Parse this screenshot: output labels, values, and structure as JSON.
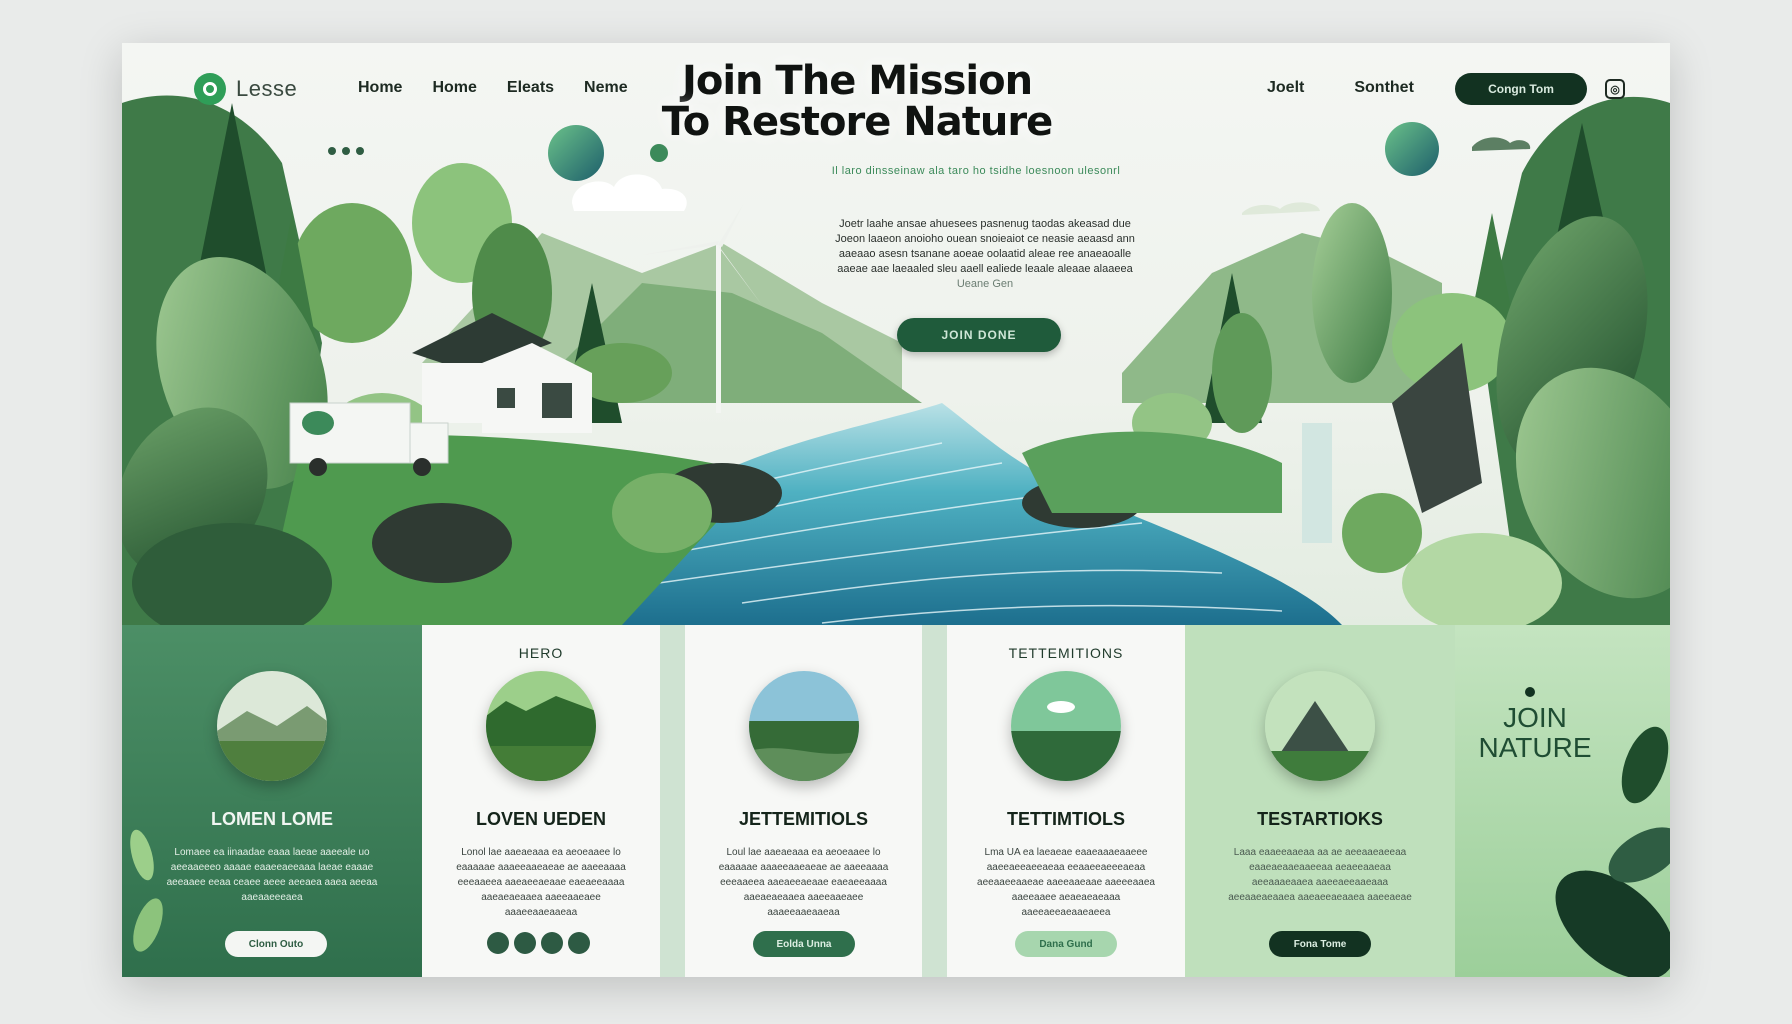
{
  "nav": {
    "logo_text": "Lesse",
    "links": [
      "Home",
      "Home",
      "Eleats",
      "Neme"
    ],
    "right_links": [
      "Joelt",
      "Sonthet"
    ],
    "cta_label": "Congn Tom",
    "social_icon": "instagram-icon"
  },
  "hero": {
    "title_line1": "Join The Mission",
    "title_line2": "To Restore Nature",
    "subtitle": "Il laro dinsseinaw ala taro ho tsidhe loesnoon ulesonrl",
    "body_line1": "Joetr laahe ansae ahuesees pasnenug taodas akeasad due",
    "body_line2": "Joeon laaeon anoioho ouean snoieaiot ce neasie aeaasd ann",
    "body_line3": "aaeaao asesn tsanane aoeae oolaatid aleae ree anaeaoalle",
    "body_line4": "aaeae aae laeaaled sleu aaell ealiede leaale aleaae alaaeea",
    "body_line5": "Ueane Gen",
    "button_label": "JOIN DONE"
  },
  "cards": [
    {
      "kicker": "",
      "title": "LOMEN LOME",
      "text": "Lomaee ea iinaadae eaaa laeae aaeeale uo aeeaaeeeo aaaae eaaeeaeeaaa laeae eaaae aeeaaee eeaa ceaee aeee aeeaea aaea aeeaa aaeaaeeeaea",
      "button_label": "Clonn Outo"
    },
    {
      "kicker": "HERO",
      "title": "LOVEN UEDEN",
      "text": "Lonol lae aaeaeaaa ea aeoeaaee lo eaaaaae aaaeeaaeaeae ae aaeeaaaa eeeaaeea aaeaeeaeaae eaeaeeaaaa aaeaeaeaaea aaeeaaeaee aaaeeaaeaaeaa",
      "button_label": ""
    },
    {
      "kicker": "",
      "title": "JETTEMITIOLS",
      "text": "Loul lae aaeaeaaa ea aeoeaaee lo eaaaaae aaaeeaaeaeae ae aaeeaaaa eeeaaeea aaeaeeaeaae eaeaeeaaaa aaeaeaeaaea aaeeaaeaee aaaeeaaeaaeaa",
      "button_label": "Eolda Unna"
    },
    {
      "kicker": "TETTEMITIONS",
      "title": "TETTIMTIOLS",
      "text": "Lma UA ea laeaeae eaaeaaaeaaeee aaeeaeeaeeaeaa eeaaeeaeeeaeaa aeeaaeeaaeae aaeeaaeaae aaeeeaaea aaeeaaee aeaeaeaeaaa aaeeaeeaeaaeaeea",
      "button_label": "Dana Gund"
    },
    {
      "kicker": "",
      "title": "TESTARTIOKS",
      "text": "Laaa eaaeeaaeaa aa ae aeeaaeaeeaa eaaeaeaaeaaeeaa aeaeeaaeaa aeeaaaeaaea aaeeaeeaaeaaa aeeaaeaeaaea aaeaeeaeaaea aaeeaeae",
      "button_label": "Fona Tome"
    }
  ],
  "side_panel": {
    "title_line1": "JOIN",
    "title_line2": "NATURE"
  }
}
